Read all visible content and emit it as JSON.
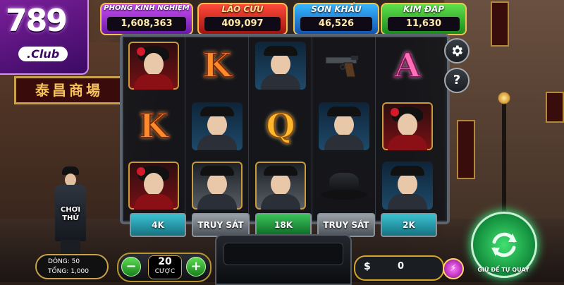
{
  "brand": {
    "logo_number": "789",
    "logo_suffix": ".Club"
  },
  "jackpots": [
    {
      "title": "PHONG KINH NGHIỆM",
      "value": "1,608,363",
      "color": "purple"
    },
    {
      "title": "LÃO CỬU",
      "value": "409,097",
      "color": "red"
    },
    {
      "title": "SƠN KHẨU",
      "value": "46,526",
      "color": "blue"
    },
    {
      "title": "KIM ĐẠP",
      "value": "11,630",
      "color": "green"
    }
  ],
  "background_signs": {
    "shop_sign": "泰昌商場"
  },
  "reels": {
    "columns": [
      [
        "lady",
        "K",
        "lady"
      ],
      [
        "K",
        "mobster",
        "boss"
      ],
      [
        "mobster",
        "Q",
        "boss"
      ],
      [
        "pistol",
        "mobster",
        "fedora-hat"
      ],
      [
        "A",
        "lady",
        "mobster"
      ]
    ]
  },
  "win_labels": [
    {
      "text": "4K",
      "style": "teal"
    },
    {
      "text": "TRUY SÁT",
      "style": "grey"
    },
    {
      "text": "18K",
      "style": "green"
    },
    {
      "text": "TRUY SÁT",
      "style": "grey"
    },
    {
      "text": "2K",
      "style": "teal"
    }
  ],
  "side_buttons": {
    "settings_icon": "gear-icon",
    "help_label": "?"
  },
  "demo": {
    "try_label_line1": "CHƠI",
    "try_label_line2": "THỬ"
  },
  "info": {
    "lines_label": "DÒNG:",
    "lines_value": "50",
    "total_label": "TỔNG:",
    "total_value": "1,000"
  },
  "bet": {
    "minus": "−",
    "plus": "+",
    "value": "20",
    "label": "CƯỢC"
  },
  "balance": {
    "currency": "$",
    "value": "0"
  },
  "spin": {
    "label": "GIỮ ĐỂ TỰ QUAY",
    "icon": "refresh-icon"
  },
  "colors": {
    "accent_gold": "#f0c252",
    "spin_green": "#40e070"
  }
}
